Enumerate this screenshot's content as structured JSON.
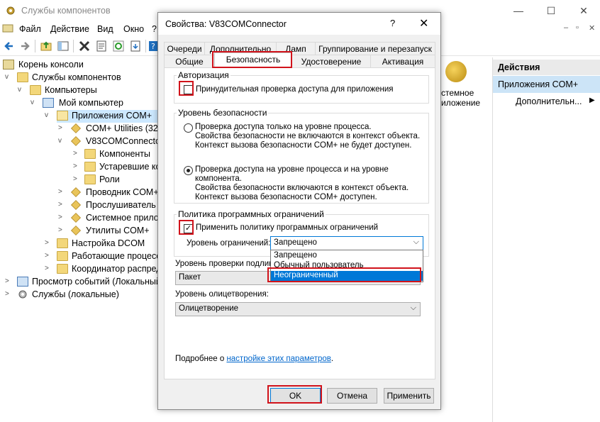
{
  "main_window": {
    "title": "Службы компонентов",
    "controls": {
      "minimize": "—",
      "maximize": "☐",
      "close": "✕"
    },
    "mdi_controls": {
      "minimize": "–",
      "restore": "▫",
      "close": "✕"
    }
  },
  "menu": [
    "Файл",
    "Действие",
    "Вид",
    "Окно",
    "?"
  ],
  "tree": [
    {
      "label": "Корень консоли",
      "expander": "",
      "icon": "console"
    },
    {
      "label": "Службы компонентов",
      "expander": "v",
      "icon": "folder"
    },
    {
      "label": "Компьютеры",
      "expander": "v",
      "icon": "folder"
    },
    {
      "label": "Мой компьютер",
      "expander": "v",
      "icon": "monitor"
    },
    {
      "label": "Приложения COM+",
      "expander": "v",
      "icon": "folder-open"
    },
    {
      "label": "COM+ Utilities (32 b",
      "expander": ">",
      "icon": "package"
    },
    {
      "label": "V83COMConnector",
      "expander": "v",
      "icon": "package"
    },
    {
      "label": "Компоненты",
      "expander": ">",
      "icon": "folder"
    },
    {
      "label": "Устаревшие ко",
      "expander": ">",
      "icon": "folder"
    },
    {
      "label": "Роли",
      "expander": ">",
      "icon": "folder"
    },
    {
      "label": "Проводник COM+",
      "expander": ">",
      "icon": "package"
    },
    {
      "label": "Прослушиватель с",
      "expander": ">",
      "icon": "package"
    },
    {
      "label": "Системное прило",
      "expander": ">",
      "icon": "package"
    },
    {
      "label": "Утилиты COM+",
      "expander": ">",
      "icon": "package"
    },
    {
      "label": "Настройка DCOM",
      "expander": ">",
      "icon": "folder"
    },
    {
      "label": "Работающие процесс",
      "expander": ">",
      "icon": "folder"
    },
    {
      "label": "Координатор распред",
      "expander": ">",
      "icon": "folder"
    },
    {
      "label": "Просмотр событий (Локальный",
      "expander": ">",
      "icon": "monitor"
    },
    {
      "label": "Службы (локальные)",
      "expander": ">",
      "icon": "gear"
    }
  ],
  "middle_pane": {
    "line1": "стемное",
    "line2": "иложение"
  },
  "actions": {
    "header": "Действия",
    "section": "Приложения COM+",
    "more": "Дополнительн..."
  },
  "dialog": {
    "title": "Свойства: V83COMConnector",
    "help": "?",
    "close": "✕",
    "tabs_row1": [
      "Очереди",
      "Дополнительно",
      "Дамп",
      "Группирование и перезапуск"
    ],
    "tabs_row2": [
      "Общие",
      "Безопасность",
      "Удостоверение",
      "Активация"
    ],
    "authorization": {
      "group": "Авторизация",
      "checkbox_label": "Принудительная проверка доступа для приложения",
      "checked": false
    },
    "security_level": {
      "group": "Уровень безопасности",
      "option1": [
        "Проверка доступа только на уровне процесса.",
        "Свойства безопасности не включаются в контекст объекта.",
        "Контекст вызова безопасности COM+ не будет доступен."
      ],
      "option2": [
        "Проверка доступа на уровне процесса и на уровне",
        "компонента.",
        "Свойства безопасности включаются в контекст объекта.",
        "Контекст вызова безопасности COM+ доступен."
      ],
      "selected": 2
    },
    "srp": {
      "group": "Политика программных ограничений",
      "checkbox_label": "Применить  политику программных ограничений",
      "checked": true,
      "level_label": "Уровень ограничений:",
      "level_value": "Запрещено",
      "options": [
        "Запрещено",
        "Обычный пользователь",
        "Неограниченный"
      ],
      "highlighted": "Неограниченный"
    },
    "auth_level": {
      "label": "Уровень проверки подлин",
      "value": "Пакет"
    },
    "impersonation": {
      "label": "Уровень олицетворения:",
      "value": "Олицетворение"
    },
    "more_info": {
      "prefix": "Подробнее о ",
      "link": "настройке этих параметров",
      "suffix": "."
    },
    "buttons": {
      "ok": "OK",
      "cancel": "Отмена",
      "apply": "Применить"
    },
    "checkmark": "✓",
    "dropdown_arrow": "⌵"
  },
  "colors": {
    "accent": "#0078d7",
    "highlight_box": "#d1131b",
    "selection": "#cce8ff",
    "actions_selected": "#cce4f7"
  }
}
